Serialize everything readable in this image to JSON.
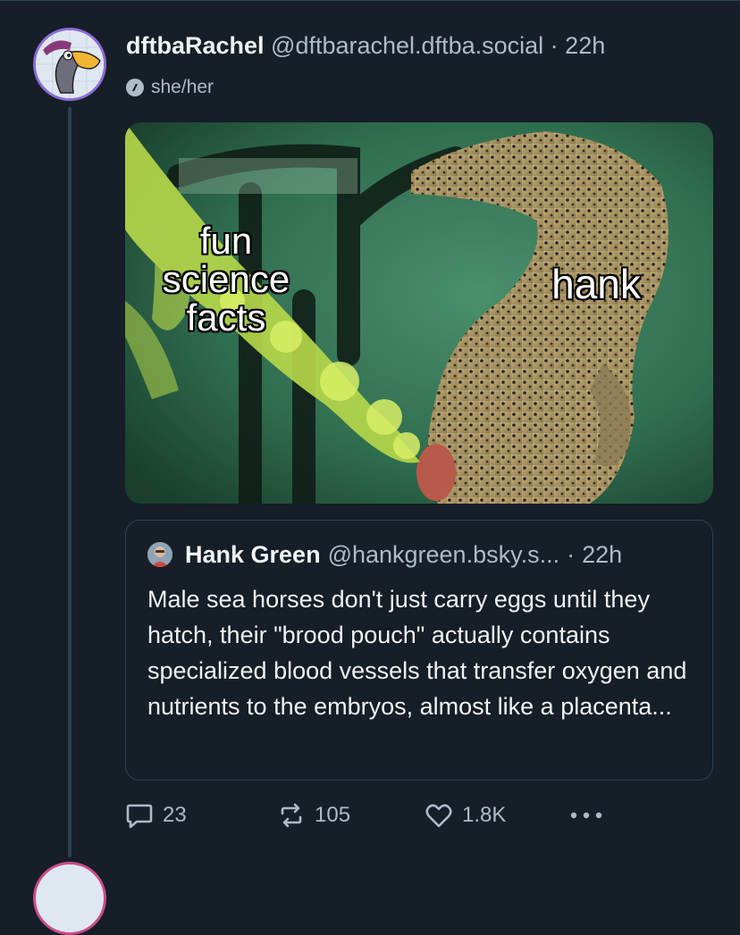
{
  "post": {
    "display_name": "dftbaRachel",
    "handle": "@dftbarachel.dftba.social",
    "separator": "·",
    "time": "22h",
    "pronouns": "she/her",
    "image_text": {
      "left_label_lines": [
        "fun",
        "science",
        "facts"
      ],
      "right_label": "hank"
    }
  },
  "quote": {
    "display_name": "Hank Green",
    "handle": "@hankgreen.bsky.s...",
    "separator": "·",
    "time": "22h",
    "text": "Male sea horses don't just carry eggs until they hatch, their \"brood pouch\" actually contains specialized blood vessels that transfer oxygen and nutrients to the embryos, almost like a placenta..."
  },
  "actions": {
    "replies": "23",
    "reposts": "105",
    "likes": "1.8K"
  },
  "colors": {
    "background": "#161e27",
    "border": "#2e4052",
    "text_primary": "#f1f3f5",
    "text_secondary": "#aebbc9"
  }
}
